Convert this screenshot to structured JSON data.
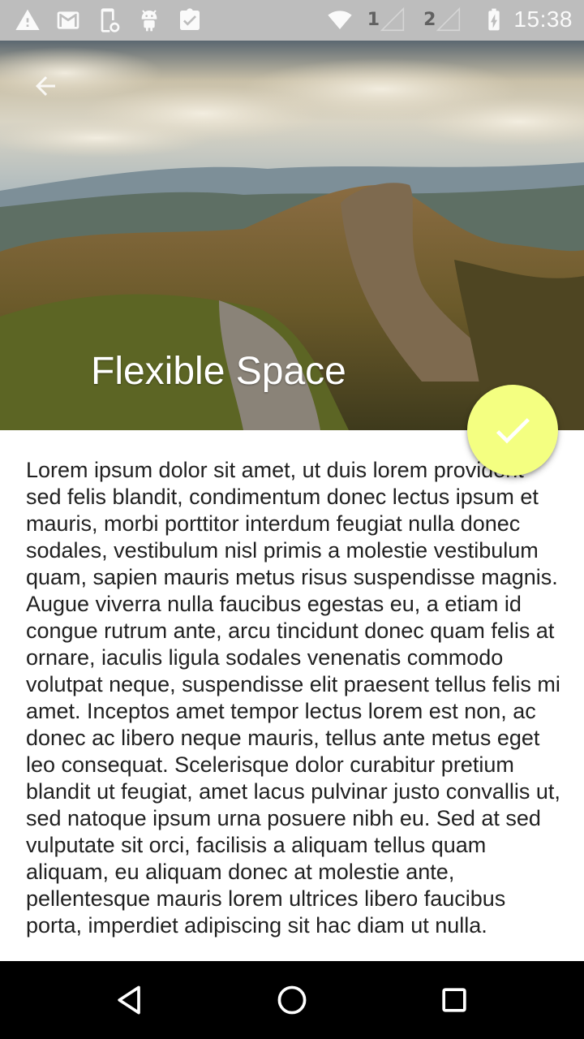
{
  "status_bar": {
    "sim1_label": "1",
    "sim2_label": "2",
    "time": "15:38",
    "icons": [
      "warning-icon",
      "gmail-icon",
      "phone-settings-icon",
      "android-icon",
      "clipboard-check-icon",
      "wifi-icon",
      "signal-icon",
      "battery-charging-icon"
    ]
  },
  "header": {
    "title": "Flexible Space",
    "back_icon": "arrow-back-icon"
  },
  "fab": {
    "icon": "check-icon",
    "color": "#f4ff81"
  },
  "content": {
    "text": "Lorem ipsum dolor sit amet, ut duis lorem provident sed felis blandit, condimentum donec lectus ipsum et mauris, morbi porttitor interdum feugiat nulla donec sodales, vestibulum nisl primis a molestie vestibulum quam, sapien mauris metus risus suspendisse magnis. Augue viverra nulla faucibus egestas eu, a etiam id congue rutrum ante, arcu tincidunt donec quam felis at ornare, iaculis ligula sodales venenatis commodo volutpat neque, suspendisse elit praesent tellus felis mi amet. Inceptos amet tempor lectus lorem est non, ac donec ac libero neque mauris, tellus ante metus eget leo consequat. Scelerisque dolor curabitur pretium blandit ut feugiat, amet lacus pulvinar justo convallis ut, sed natoque ipsum urna posuere nibh eu. Sed at sed vulputate sit orci, facilisis a aliquam tellus quam aliquam, eu aliquam donec at molestie ante, pellentesque mauris lorem ultrices libero faucibus porta, imperdiet adipiscing sit hac diam ut nulla."
  },
  "nav_bar": {
    "icons": [
      "back-triangle-icon",
      "home-circle-icon",
      "recents-square-icon"
    ]
  }
}
